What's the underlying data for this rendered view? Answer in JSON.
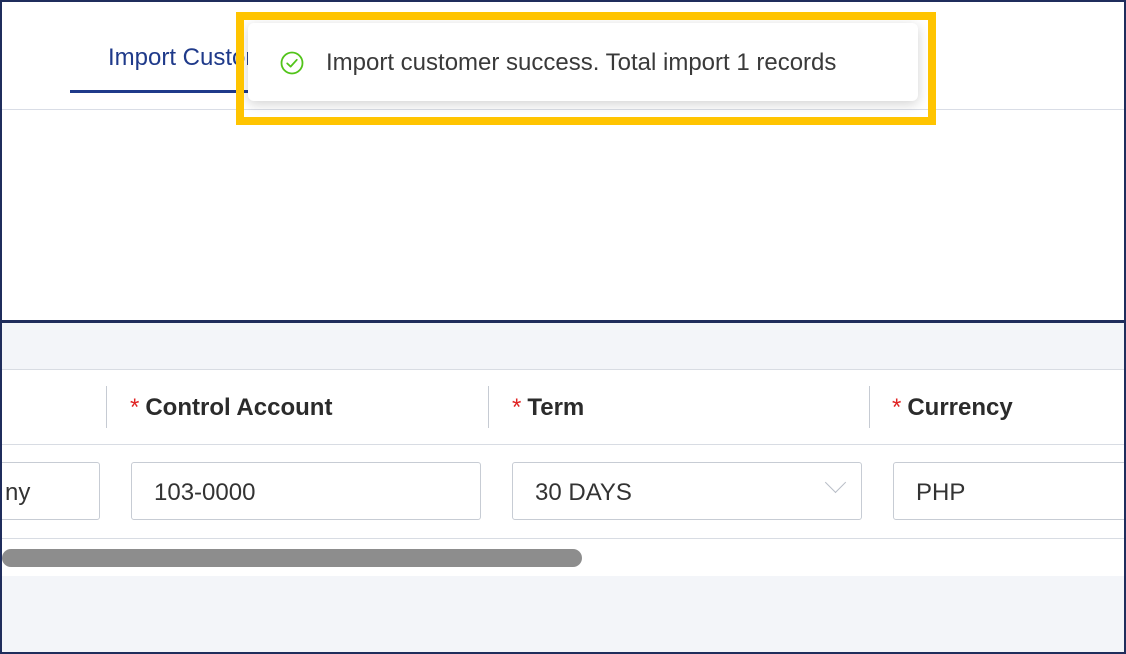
{
  "tabs": [
    {
      "label": "Import Customer"
    }
  ],
  "toast": {
    "icon": "check-circle-icon",
    "message": "Import customer success. Total import 1 records",
    "status_color": "#52c41a"
  },
  "table": {
    "headers": {
      "control_account": "Control Account",
      "term": "Term",
      "currency": "Currency"
    },
    "required_marker": "*",
    "row": {
      "company_partial": "ny",
      "control_account": "103-0000",
      "term": "30 DAYS",
      "currency": "PHP"
    }
  },
  "colors": {
    "accent": "#1f3a8a",
    "highlight": "#ffc400",
    "required": "#e02424"
  }
}
